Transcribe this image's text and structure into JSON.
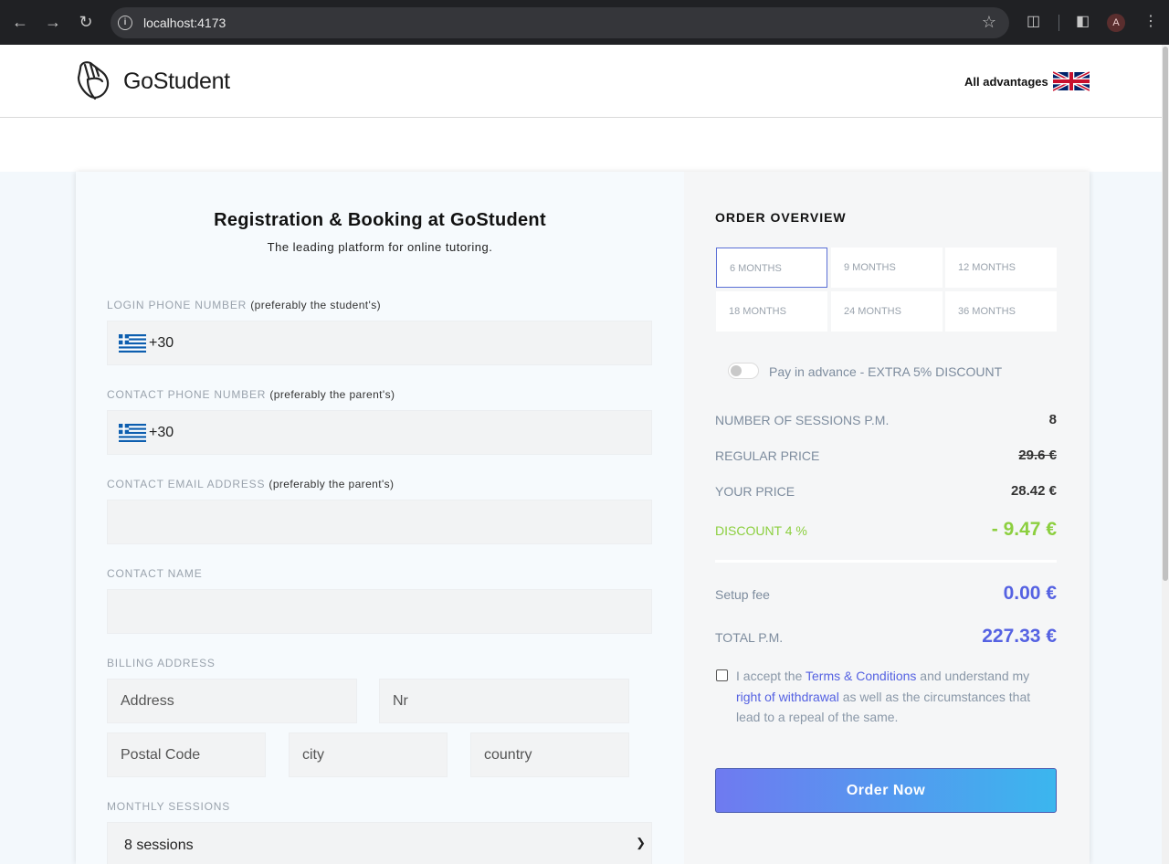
{
  "browser": {
    "url": "localhost:4173",
    "avatar_letter": "A"
  },
  "header": {
    "brand": "GoStudent",
    "advantages_link": "All advantages"
  },
  "form": {
    "title": "Registration & Booking at GoStudent",
    "subtitle": "The leading platform for online tutoring.",
    "login_phone": {
      "label": "LOGIN PHONE NUMBER",
      "hint": "(preferably the student's)",
      "code": "+30"
    },
    "contact_phone": {
      "label": "CONTACT PHONE NUMBER",
      "hint": "(preferably the parent's)",
      "code": "+30"
    },
    "contact_email": {
      "label": "CONTACT EMAIL ADDRESS",
      "hint": "(preferably the parent's)"
    },
    "contact_name": {
      "label": "CONTACT NAME"
    },
    "billing": {
      "label": "BILLING ADDRESS",
      "address_placeholder": "Address",
      "nr_placeholder": "Nr",
      "postal_placeholder": "Postal Code",
      "city_placeholder": "city",
      "country_placeholder": "country"
    },
    "monthly_sessions": {
      "label": "MONTHLY SESSIONS",
      "selected": "8 sessions"
    }
  },
  "overview": {
    "title": "ORDER OVERVIEW",
    "durations": [
      "6 MONTHS",
      "9 MONTHS",
      "12 MONTHS",
      "18 MONTHS",
      "24 MONTHS",
      "36 MONTHS"
    ],
    "selected_duration": "6 MONTHS",
    "pay_in_advance": {
      "label": "Pay in advance - EXTRA 5% DISCOUNT",
      "enabled": false
    },
    "sessions_label": "NUMBER OF SESSIONS P.M.",
    "sessions_value": "8",
    "regular_label": "REGULAR PRICE",
    "regular_value": "29.6 €",
    "your_label": "YOUR PRICE",
    "your_value": "28.42 €",
    "discount_label": "DISCOUNT 4 %",
    "discount_value": "- 9.47 €",
    "setup_label": "Setup fee",
    "setup_value": "0.00 €",
    "total_label": "TOTAL P.M.",
    "total_value": "227.33 €",
    "terms": {
      "part1": "I accept the ",
      "link1": "Terms & Conditions",
      "part2": " and understand my ",
      "link2": "right of withdrawal",
      "part3": " as well as the circumstances that lead to a repeal of the same."
    },
    "order_button": "Order Now"
  },
  "colors": {
    "accent_blue": "#5562e2",
    "discount_green": "#8ccf3f",
    "button_gradient_start": "#6f7af0",
    "button_gradient_end": "#3bb6ee"
  }
}
